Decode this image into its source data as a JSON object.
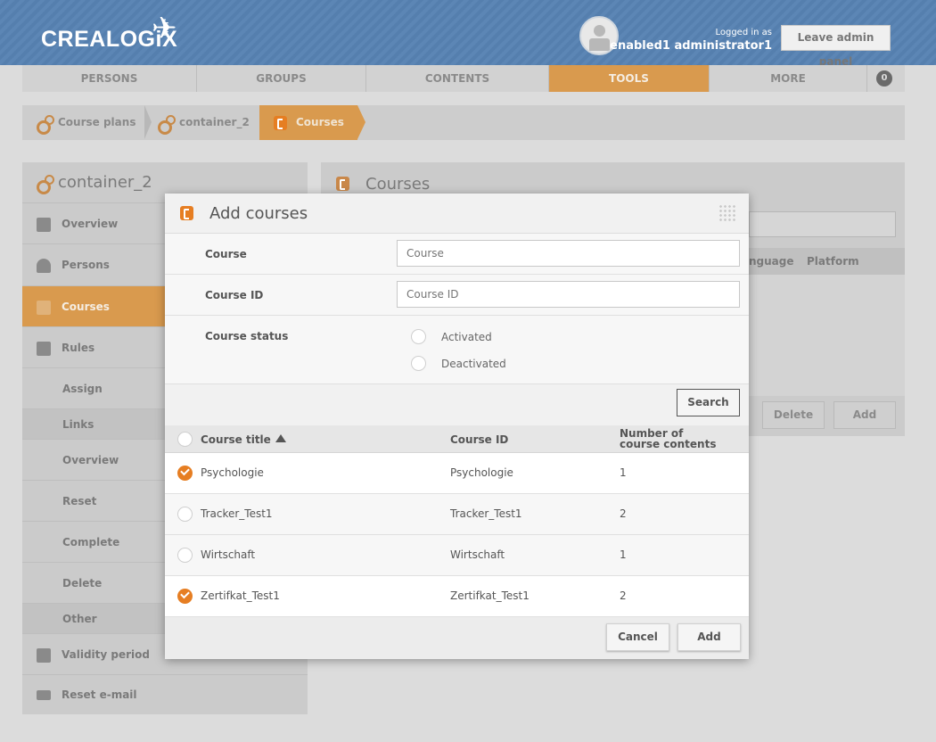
{
  "header": {
    "logo_text": "CREALOGiX",
    "login_label": "Logged in as",
    "user_name": "enabled1 administrator1",
    "leave_button": "Leave admin panel"
  },
  "nav": {
    "items": [
      "PERSONS",
      "GROUPS",
      "CONTENTS",
      "TOOLS",
      "MORE"
    ],
    "active": "TOOLS",
    "count": "0"
  },
  "breadcrumb": {
    "items": [
      "Course plans",
      "container_2",
      "Courses"
    ]
  },
  "left_panel": {
    "title": "container_2",
    "items": [
      "Overview",
      "Persons",
      "Courses",
      "Rules",
      "Assign",
      "Links",
      "Overview",
      "Reset",
      "Complete",
      "Delete",
      "Other",
      "Validity period",
      "Reset e-mail"
    ],
    "active": "Courses"
  },
  "right_panel": {
    "title": "Courses",
    "columns": [
      "nguage",
      "Platform"
    ],
    "buttons": [
      "Delete",
      "Add"
    ]
  },
  "modal": {
    "title": "Add courses",
    "fields": {
      "course_label": "Course",
      "course_placeholder": "Course",
      "course_id_label": "Course ID",
      "course_id_placeholder": "Course ID",
      "status_label": "Course status",
      "status_options": [
        "Activated",
        "Deactivated"
      ]
    },
    "search_button": "Search",
    "table": {
      "columns": [
        "Course title",
        "Course ID",
        "Number of course contents"
      ],
      "sort_column": "Course title",
      "rows": [
        {
          "title": "Psychologie",
          "course_id": "Psychologie",
          "contents": "1",
          "selected": true
        },
        {
          "title": "Tracker_Test1",
          "course_id": "Tracker_Test1",
          "contents": "2",
          "selected": false
        },
        {
          "title": "Wirtschaft",
          "course_id": "Wirtschaft",
          "contents": "1",
          "selected": false
        },
        {
          "title": "Zertifkat_Test1",
          "course_id": "Zertifkat_Test1",
          "contents": "2",
          "selected": true
        }
      ]
    },
    "cancel_button": "Cancel",
    "add_button": "Add"
  },
  "colors": {
    "accent": "#e67e22",
    "header_blue": "#5c86b5",
    "nav_active": "#d99a4e"
  }
}
